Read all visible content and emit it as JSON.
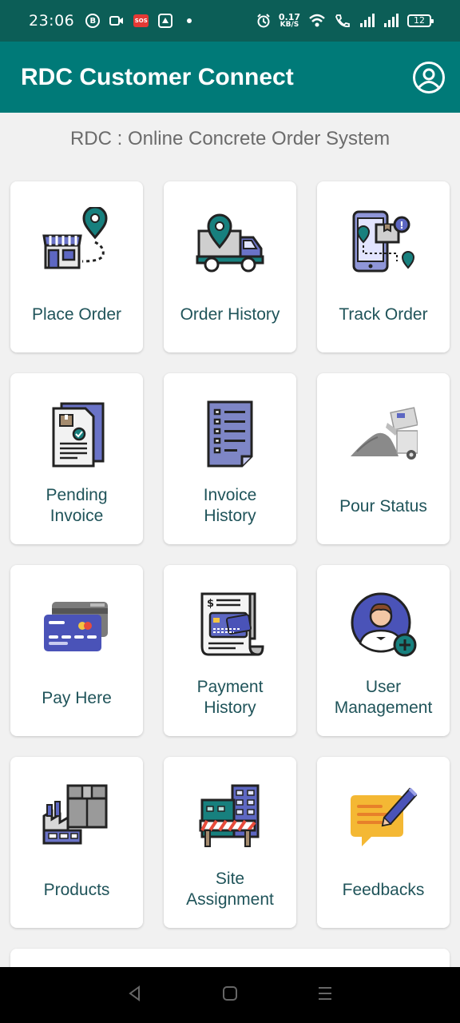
{
  "status_bar": {
    "time": "23:06",
    "b_badge": "B",
    "sos": "SOS",
    "speed_value": "0.17",
    "speed_unit": "KB/S",
    "battery": "12"
  },
  "app_bar": {
    "title": "RDC Customer Connect",
    "profile_icon": "user-circle-icon"
  },
  "subtitle": "RDC : Online Concrete Order System",
  "tiles": [
    {
      "label": "Place Order",
      "icon": "shop-location-icon"
    },
    {
      "label": "Order History",
      "icon": "truck-location-icon"
    },
    {
      "label": "Track Order",
      "icon": "phone-tracking-icon"
    },
    {
      "label": "Pending\nInvoice",
      "icon": "pending-invoice-icon"
    },
    {
      "label": "Invoice\nHistory",
      "icon": "invoice-document-icon"
    },
    {
      "label": "Pour Status",
      "icon": "concrete-pour-icon"
    },
    {
      "label": "Pay Here",
      "icon": "credit-cards-icon"
    },
    {
      "label": "Payment\nHistory",
      "icon": "payment-receipt-icon"
    },
    {
      "label": "User\nManagement",
      "icon": "user-add-icon"
    },
    {
      "label": "Products",
      "icon": "factory-box-icon"
    },
    {
      "label": "Site\nAssignment",
      "icon": "construction-site-icon"
    },
    {
      "label": "Feedbacks",
      "icon": "feedback-pencil-icon"
    }
  ],
  "colors": {
    "status_bar": "#0c5e57",
    "app_bar": "#007a78",
    "label_text": "#20545a",
    "background": "#f1f1f1"
  }
}
